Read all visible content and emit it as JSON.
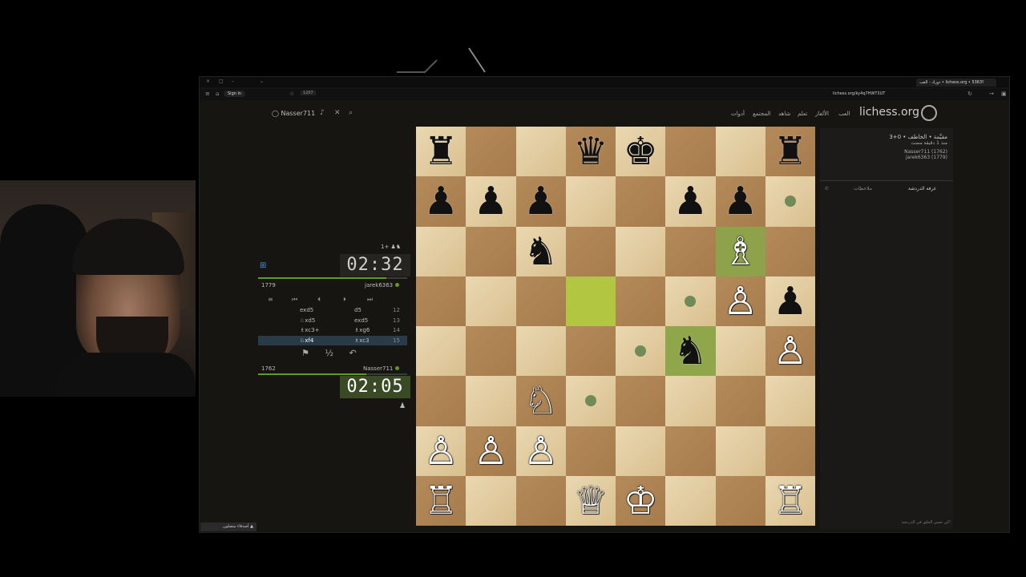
{
  "browser": {
    "tab_title": "دورك - العب • lichess.org • ؟5363",
    "url": "lichess.org/ky4q7HWT3UT",
    "signin": "Sign in",
    "tab_count": "1207"
  },
  "header": {
    "logo": "lichess.org",
    "nav": [
      "العب",
      "الألغاز",
      "تعلم",
      "شاهد",
      "المجتمع",
      "أدوات"
    ],
    "user": "Nasser711"
  },
  "game_info": {
    "title": "3+0 • مقيَّمة • الخاطف",
    "subtitle": "منذ 1 دقيقة مضت",
    "white": "Nasser711 (1762)",
    "black": "jarek6363 (1779)"
  },
  "top_player": {
    "name": "jarek6363",
    "rating": "1779",
    "clock": "02:32",
    "extra": "1+"
  },
  "bottom_player": {
    "name": "Nasser711",
    "rating": "1762",
    "clock": "02:05"
  },
  "moves": [
    {
      "n": "12",
      "w": "d5",
      "b": "exd5"
    },
    {
      "n": "13",
      "w": "exd5",
      "b": "♘xd5"
    },
    {
      "n": "14",
      "w": "♗xg6",
      "b": "♗xc3+"
    },
    {
      "n": "15",
      "w": "♗xc3",
      "b": "♘xf4"
    }
  ],
  "actions": [
    "⚑",
    "½",
    "↶"
  ],
  "chat": {
    "tab_room": "غرفة الدردشة",
    "tab_notes": "ملاحظات",
    "placeholder": "كن حسن الخلق في الدردشة!"
  },
  "friends": "أصدقاء متصلون",
  "board": [
    [
      "♜",
      "",
      "",
      "♛",
      "♚",
      "",
      "",
      "♜"
    ],
    [
      "♟",
      "♟",
      "♟",
      "",
      "",
      "♟",
      "♟",
      "*"
    ],
    [
      "",
      "",
      "♞",
      "",
      "",
      "",
      "♗",
      ""
    ],
    [
      "",
      "",
      "",
      "",
      "",
      "*",
      "♙",
      "♟"
    ],
    [
      "",
      "",
      "",
      "",
      "*",
      "♞",
      "",
      "♙"
    ],
    [
      "",
      "",
      "♘",
      "*",
      "",
      "",
      "",
      ""
    ],
    [
      "♙",
      "♙",
      "♙",
      "",
      "",
      "",
      "",
      ""
    ],
    [
      "♖",
      "",
      "",
      "♕",
      "♔",
      "",
      "",
      "♖"
    ]
  ],
  "board_colors": [
    "w",
    "b"
  ],
  "white_pieces": "♔♕♖♗♘♙",
  "colors": {
    "accent": "#629924",
    "highlight": "#b2c642",
    "background": "#161512"
  }
}
